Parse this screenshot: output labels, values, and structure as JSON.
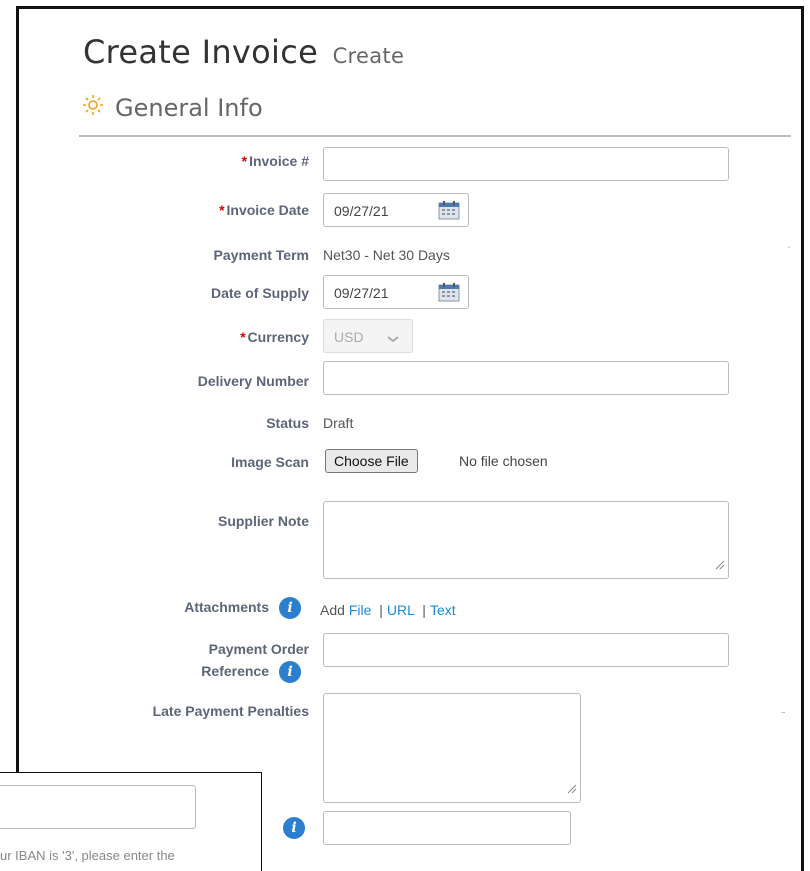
{
  "header": {
    "title": "Create Invoice",
    "subtitle": "Create"
  },
  "section": {
    "title": "General Info",
    "icon": "gear-icon",
    "icon_color": "#f0a020"
  },
  "fields": {
    "invoice_number": {
      "label": "Invoice #",
      "required": "*",
      "value": ""
    },
    "invoice_date": {
      "label": "Invoice Date",
      "required": "*",
      "value": "09/27/21"
    },
    "payment_term": {
      "label": "Payment Term",
      "value": "Net30 - Net 30 Days"
    },
    "date_of_supply": {
      "label": "Date of Supply",
      "value": "09/27/21"
    },
    "currency": {
      "label": "Currency",
      "required": "*",
      "value": "USD"
    },
    "delivery_number": {
      "label": "Delivery Number",
      "value": ""
    },
    "status": {
      "label": "Status",
      "value": "Draft"
    },
    "image_scan": {
      "label": "Image Scan",
      "button": "Choose File",
      "file_status": "No file chosen"
    },
    "supplier_note": {
      "label": "Supplier Note",
      "value": ""
    },
    "attachments": {
      "label": "Attachments",
      "add": "Add",
      "file": "File",
      "url": "URL",
      "text": "Text",
      "sep1": "|",
      "sep2": "|"
    },
    "payment_order_reference": {
      "label_line1": "Payment Order",
      "label_line2": "Reference",
      "value": ""
    },
    "late_payment_penalties": {
      "label": "Late Payment Penalties",
      "value": ""
    }
  },
  "stray": {
    "dot1": ".",
    "dot2": "-"
  },
  "popup": {
    "text": "ur IBAN is '3', please enter the"
  },
  "colors": {
    "link": "#1a8bd8",
    "required": "#dd0000",
    "label": "#5c6678",
    "info": "#2a7fd0"
  }
}
